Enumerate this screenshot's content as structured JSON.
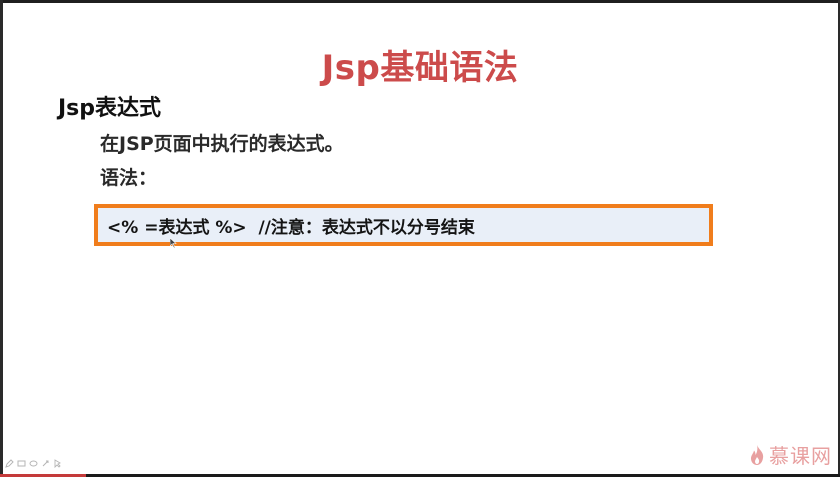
{
  "slide": {
    "title": "Jsp基础语法",
    "heading": "Jsp表达式",
    "description": "在JSP页面中执行的表达式。",
    "syntax_label": "语法：",
    "code": "<% =表达式 %>  //注意：表达式不以分号结束"
  },
  "branding": {
    "logo_text": "慕课网"
  },
  "toolbar": {
    "icons": [
      "pen-icon",
      "highlighter-icon",
      "eraser-icon",
      "shape-icon",
      "pointer-icon"
    ]
  },
  "colors": {
    "title": "#cc4b4b",
    "code_border": "#f07d1c",
    "code_background": "#e9eff8",
    "logo": "#e8a0a0"
  }
}
